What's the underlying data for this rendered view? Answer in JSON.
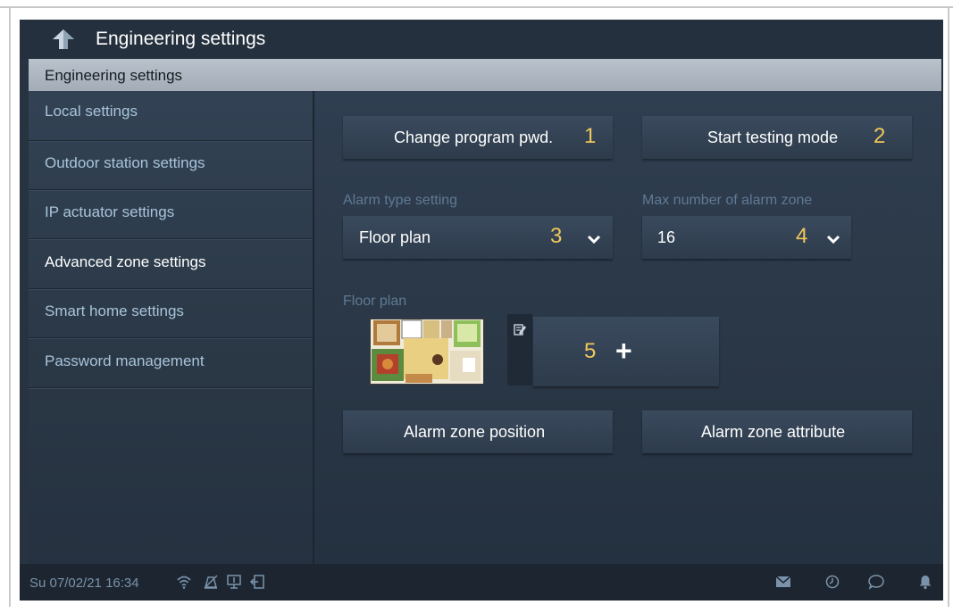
{
  "window": {
    "title": "Engineering settings"
  },
  "header": {
    "section": "Engineering settings"
  },
  "sidebar": {
    "items": [
      {
        "label": "Local settings"
      },
      {
        "label": "Outdoor station settings"
      },
      {
        "label": "IP actuator settings"
      },
      {
        "label": "Advanced zone settings"
      },
      {
        "label": "Smart home settings"
      },
      {
        "label": "Password management"
      }
    ],
    "active_index": 3
  },
  "main": {
    "change_pwd_label": "Change program pwd.",
    "change_pwd_marker": "1",
    "testing_mode_label": "Start testing mode",
    "testing_mode_marker": "2",
    "alarm_type": {
      "label": "Alarm type setting",
      "value": "Floor plan",
      "marker": "3"
    },
    "max_zone": {
      "label": "Max number of alarm zone",
      "value": "16",
      "marker": "4"
    },
    "floor_plan": {
      "label": "Floor plan",
      "add_marker": "5",
      "add_symbol": "+"
    },
    "zone_position_label": "Alarm zone position",
    "zone_attribute_label": "Alarm zone attribute"
  },
  "statusbar": {
    "datetime": "Su 07/02/21  16:34",
    "icons": [
      "wifi-icon",
      "mute-icon",
      "monitor-icon",
      "door-exit-icon",
      "mail-icon",
      "history-icon",
      "chat-icon",
      "bell-icon"
    ]
  },
  "colors": {
    "background": "#273341",
    "accent_marker": "#f1c75a",
    "sidebar_text": "#a8c4da",
    "active_text": "#ffffff"
  }
}
